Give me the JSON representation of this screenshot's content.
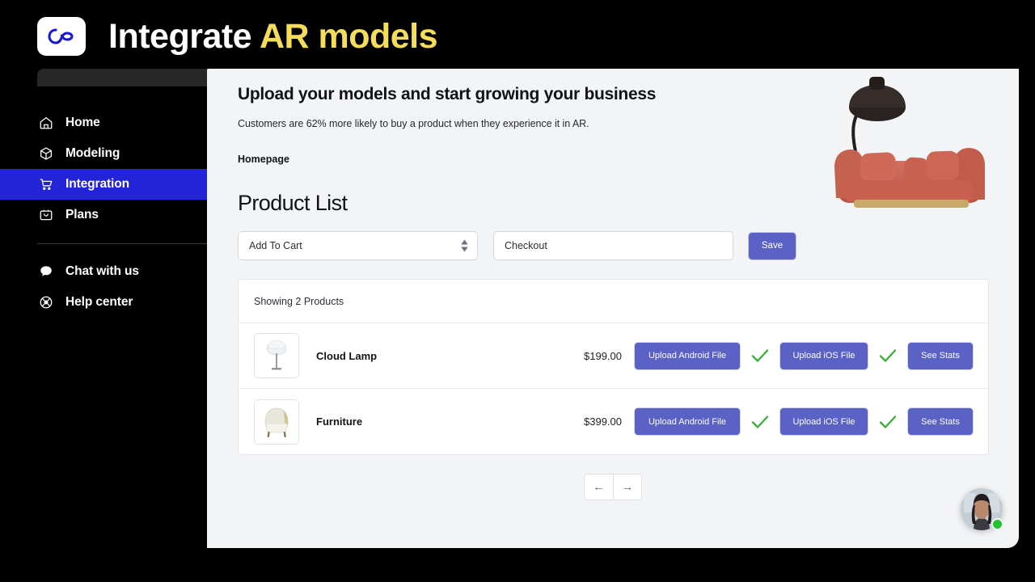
{
  "brand": {
    "title_main": "Integrate ",
    "title_accent": "AR models",
    "logo_icon": "infinity-logo-icon",
    "accent_color": "#f4dd5a",
    "background_color": "#000000"
  },
  "sidebar": {
    "items": [
      {
        "label": "Home",
        "icon": "home-icon",
        "active": false
      },
      {
        "label": "Modeling",
        "icon": "cube-icon",
        "active": false
      },
      {
        "label": "Integration",
        "icon": "shopping-cart-icon",
        "active": true
      },
      {
        "label": "Plans",
        "icon": "briefcase-icon",
        "active": false
      }
    ],
    "secondary_items": [
      {
        "label": "Chat with us",
        "icon": "chat-bubble-icon"
      },
      {
        "label": "Help center",
        "icon": "lifebuoy-icon"
      }
    ],
    "active_color": "#2323d8"
  },
  "hero": {
    "title": "Upload your models and start growing your business",
    "subtitle": "Customers are 62% more likely to buy a product when they experience it in AR.",
    "breadcrumb": "Homepage",
    "artwork_alt": "red-sofa-and-lamp-image"
  },
  "main": {
    "section_title": "Product List",
    "controls": {
      "select_value": "Add To Cart",
      "select_icon": "stepper-arrows-icon",
      "input_value": "Checkout",
      "input_placeholder": "Checkout",
      "save_label": "Save"
    },
    "table": {
      "summary": "Showing 2 Products",
      "rows": [
        {
          "thumb_icon": "floor-lamp-thumbnail",
          "name": "Cloud Lamp",
          "price": "$199.00",
          "android_label": "Upload Android File",
          "android_status_icon": "green-check-icon",
          "ios_label": "Upload iOS File",
          "ios_status_icon": "green-check-icon",
          "stats_label": "See Stats"
        },
        {
          "thumb_icon": "armchair-thumbnail",
          "name": "Furniture",
          "price": "$399.00",
          "android_label": "Upload Android File",
          "android_status_icon": "green-check-icon",
          "ios_label": "Upload iOS File",
          "ios_status_icon": "green-check-icon",
          "stats_label": "See Stats"
        }
      ]
    },
    "pagination": {
      "prev_label": "←",
      "next_label": "→"
    }
  },
  "chat": {
    "avatar_alt": "support-agent-avatar",
    "online_status_color": "#21c32f"
  },
  "colors": {
    "button_purple": "#5a62c6",
    "check_green": "#3aad3a",
    "panel_background": "#f3f4f6"
  }
}
